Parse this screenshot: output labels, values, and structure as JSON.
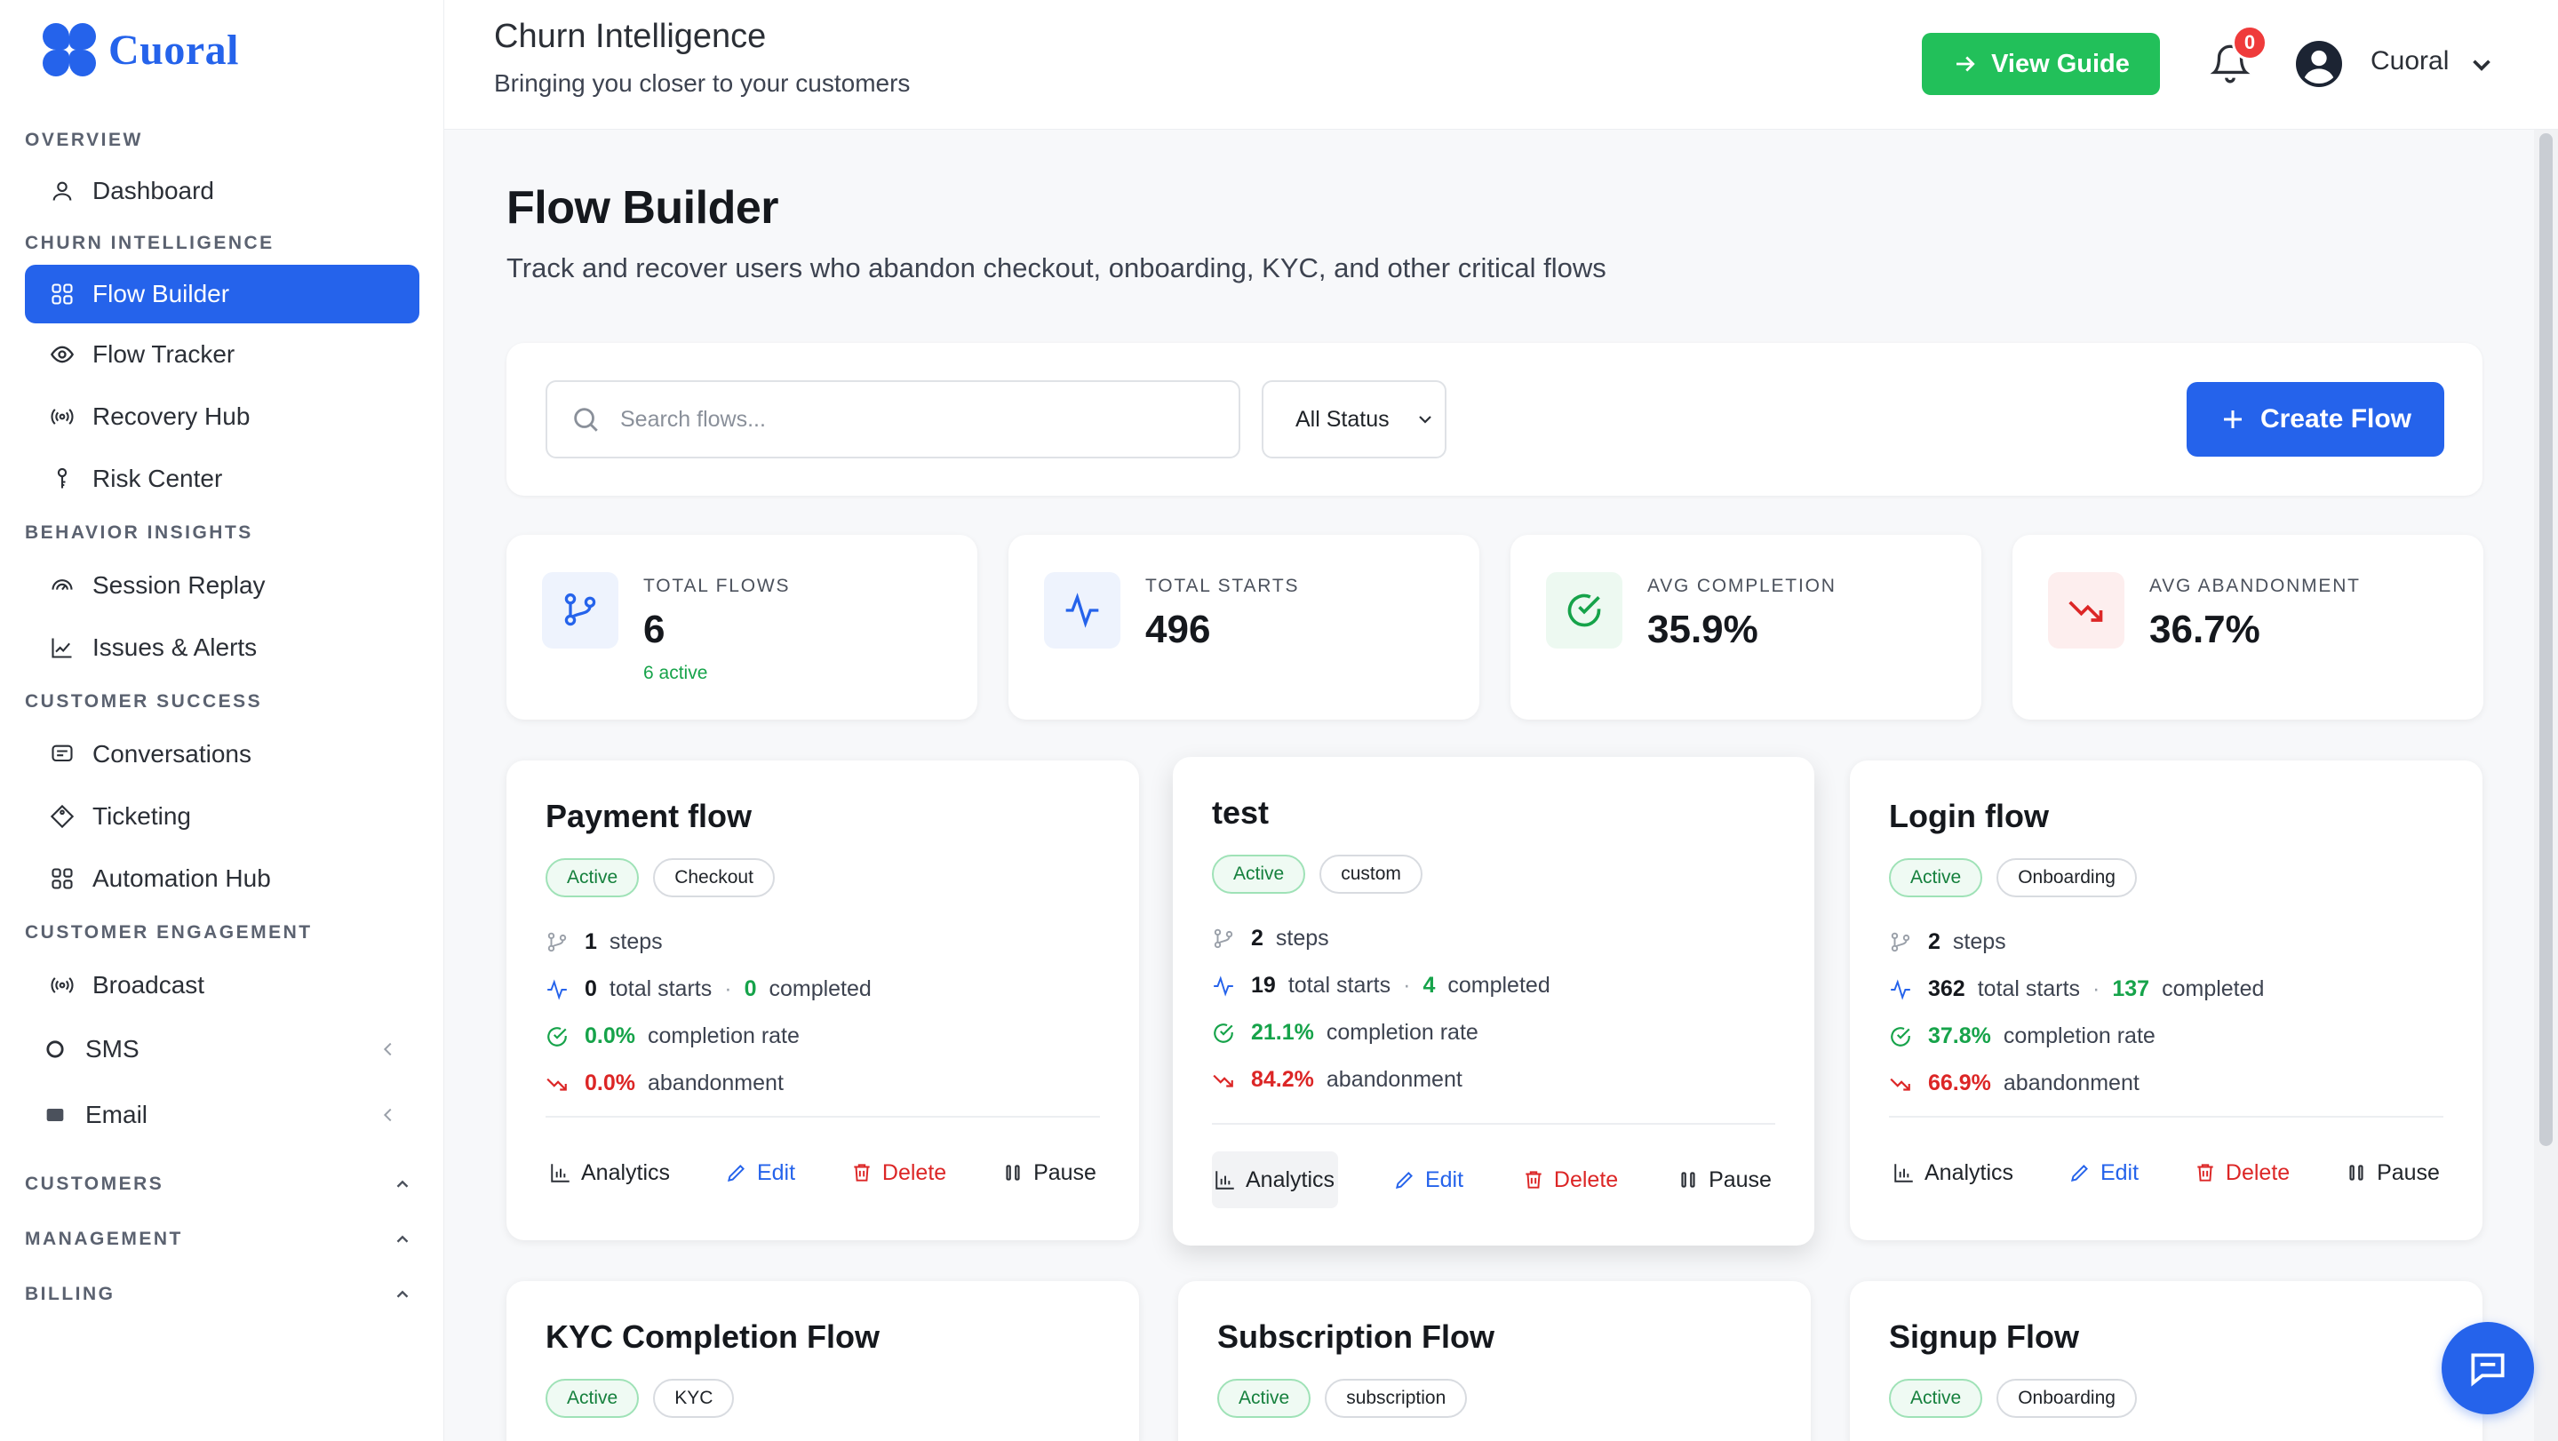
{
  "brand": {
    "name": "Cuoral",
    "color": "#2563eb"
  },
  "sidebar": {
    "sections": [
      {
        "title": "OVERVIEW",
        "items": [
          {
            "label": "Dashboard",
            "icon": "user-icon"
          }
        ]
      },
      {
        "title": "CHURN INTELLIGENCE",
        "items": [
          {
            "label": "Flow Builder",
            "icon": "grid-icon",
            "active": true
          },
          {
            "label": "Flow Tracker",
            "icon": "eye-icon"
          },
          {
            "label": "Recovery Hub",
            "icon": "broadcast-icon"
          },
          {
            "label": "Risk Center",
            "icon": "key-icon"
          }
        ]
      },
      {
        "title": "BEHAVIOR INSIGHTS",
        "items": [
          {
            "label": "Session Replay",
            "icon": "gauge-icon"
          },
          {
            "label": "Issues & Alerts",
            "icon": "chart-line-icon"
          }
        ]
      },
      {
        "title": "CUSTOMER SUCCESS",
        "items": [
          {
            "label": "Conversations",
            "icon": "message-icon"
          },
          {
            "label": "Ticketing",
            "icon": "tag-icon"
          },
          {
            "label": "Automation Hub",
            "icon": "grid-icon"
          }
        ]
      },
      {
        "title": "CUSTOMER ENGAGEMENT",
        "items": [
          {
            "label": "Broadcast",
            "icon": "broadcast-icon"
          },
          {
            "label": "SMS",
            "icon": "circle-icon"
          },
          {
            "label": "Email",
            "icon": "mail-icon"
          }
        ]
      }
    ],
    "collapsed": [
      "CUSTOMERS",
      "MANAGEMENT",
      "BILLING"
    ]
  },
  "header": {
    "title": "Churn Intelligence",
    "subtitle": "Bringing you closer to your customers",
    "guide_label": "View Guide",
    "notifications": "0",
    "user": "Cuoral"
  },
  "page": {
    "title": "Flow Builder",
    "subtitle": "Track and recover users who abandon checkout, onboarding, KYC, and other critical flows"
  },
  "toolbar": {
    "search_placeholder": "Search flows...",
    "status_value": "All Status",
    "create_label": "Create Flow"
  },
  "stats": [
    {
      "label": "TOTAL FLOWS",
      "value": "6",
      "note": "6 active",
      "icon": "branch-icon",
      "tint": "#eef3fd",
      "color": "#2563eb"
    },
    {
      "label": "TOTAL STARTS",
      "value": "496",
      "note": "",
      "icon": "activity-icon",
      "tint": "#eef3fd",
      "color": "#2563eb"
    },
    {
      "label": "AVG COMPLETION",
      "value": "35.9%",
      "note": "",
      "icon": "check-circle-icon",
      "tint": "#edf9f1",
      "color": "#16a34a"
    },
    {
      "label": "AVG ABANDONMENT",
      "value": "36.7%",
      "note": "",
      "icon": "trend-down-icon",
      "tint": "#fdeeee",
      "color": "#dc2626"
    }
  ],
  "labels": {
    "steps": "steps",
    "total_starts": "total starts",
    "completed": "completed",
    "completion_rate": "completion rate",
    "abandonment": "abandonment",
    "analytics": "Analytics",
    "edit": "Edit",
    "delete": "Delete",
    "pause": "Pause"
  },
  "flows": [
    {
      "name": "Payment flow",
      "status": "Active",
      "type": "Checkout",
      "steps": "1",
      "starts": "0",
      "completed": "0",
      "completion": "0.0%",
      "abandonment": "0.0%"
    },
    {
      "name": "test",
      "status": "Active",
      "type": "custom",
      "steps": "2",
      "starts": "19",
      "completed": "4",
      "completion": "21.1%",
      "abandonment": "84.2%"
    },
    {
      "name": "Login flow",
      "status": "Active",
      "type": "Onboarding",
      "steps": "2",
      "starts": "362",
      "completed": "137",
      "completion": "37.8%",
      "abandonment": "66.9%"
    },
    {
      "name": "KYC Completion Flow",
      "status": "Active",
      "type": "KYC"
    },
    {
      "name": "Subscription Flow",
      "status": "Active",
      "type": "subscription"
    },
    {
      "name": "Signup Flow",
      "status": "Active",
      "type": "Onboarding"
    }
  ]
}
